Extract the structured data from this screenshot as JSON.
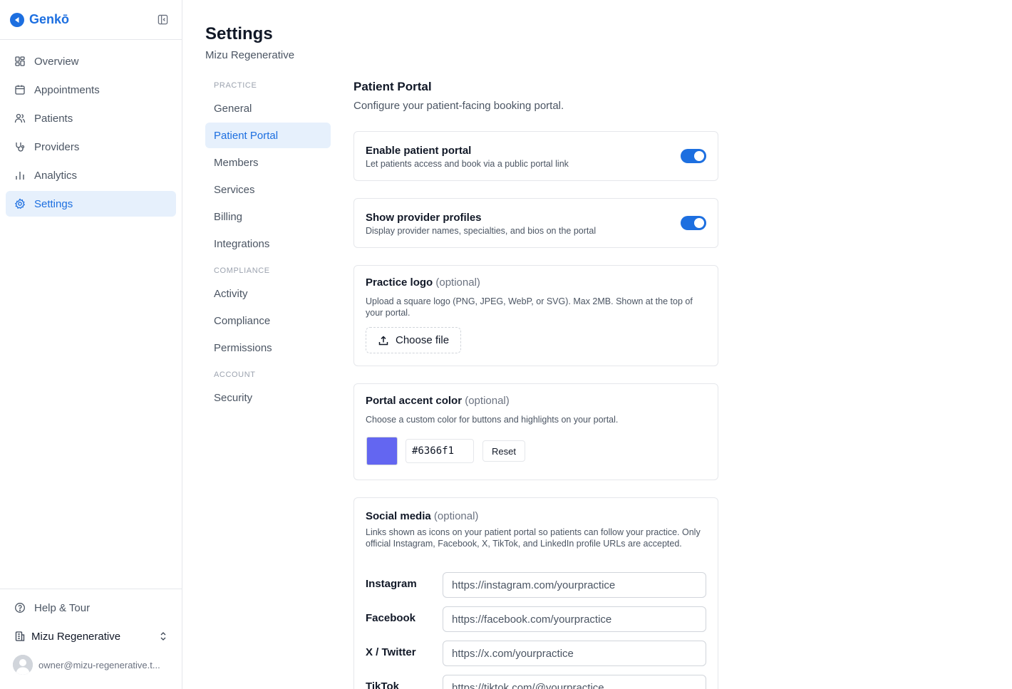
{
  "brand": {
    "name": "Genkō"
  },
  "sidebar": {
    "items": [
      {
        "label": "Overview",
        "icon": "grid-icon"
      },
      {
        "label": "Appointments",
        "icon": "calendar-icon"
      },
      {
        "label": "Patients",
        "icon": "users-icon"
      },
      {
        "label": "Providers",
        "icon": "stethoscope-icon"
      },
      {
        "label": "Analytics",
        "icon": "bar-chart-icon"
      },
      {
        "label": "Settings",
        "icon": "gear-icon",
        "active": true
      }
    ],
    "help_label": "Help & Tour",
    "practice_name": "Mizu Regenerative",
    "user_email": "owner@mizu-regenerative.t..."
  },
  "page": {
    "title": "Settings",
    "subtitle": "Mizu Regenerative"
  },
  "settings_nav": {
    "section_practice": "PRACTICE",
    "section_compliance": "COMPLIANCE",
    "section_account": "ACCOUNT",
    "general": "General",
    "patient_portal": "Patient Portal",
    "members": "Members",
    "services": "Services",
    "billing": "Billing",
    "integrations": "Integrations",
    "activity": "Activity",
    "compliance": "Compliance",
    "permissions": "Permissions",
    "security": "Security"
  },
  "portal": {
    "title": "Patient Portal",
    "subtitle": "Configure your patient-facing booking portal.",
    "enable": {
      "title": "Enable patient portal",
      "desc": "Let patients access and book via a public portal link",
      "on": true
    },
    "profiles": {
      "title": "Show provider profiles",
      "desc": "Display provider names, specialties, and bios on the portal",
      "on": true
    },
    "logo": {
      "title": "Practice logo",
      "optional": "(optional)",
      "desc": "Upload a square logo (PNG, JPEG, WebP, or SVG). Max 2MB. Shown at the top of your portal.",
      "button": "Choose file"
    },
    "accent": {
      "title": "Portal accent color",
      "optional": "(optional)",
      "desc": "Choose a custom color for buttons and highlights on your portal.",
      "value": "#6366f1",
      "reset": "Reset"
    },
    "social": {
      "title": "Social media",
      "optional": "(optional)",
      "desc": "Links shown as icons on your patient portal so patients can follow your practice. Only official Instagram, Facebook, X, TikTok, and LinkedIn profile URLs are accepted.",
      "instagram_label": "Instagram",
      "instagram_placeholder": "https://instagram.com/yourpractice",
      "facebook_label": "Facebook",
      "facebook_placeholder": "https://facebook.com/yourpractice",
      "x_label": "X / Twitter",
      "x_placeholder": "https://x.com/yourpractice",
      "tiktok_label": "TikTok",
      "tiktok_placeholder": "https://tiktok.com/@yourpractice"
    }
  },
  "colors": {
    "accent": "#1d6fe0",
    "accent_bg": "#e6f0fc",
    "swatch": "#6366f1"
  }
}
